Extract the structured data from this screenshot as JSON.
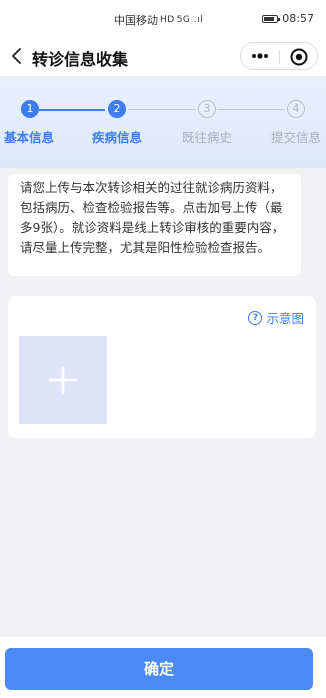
{
  "status_bar": {
    "carrier": "中国移动",
    "network": "HD",
    "signal": "5G .ıl",
    "time": "08:57",
    "battery_level": 0.8
  },
  "nav": {
    "title": "转诊信息收集",
    "back_icon": "chevron-left-icon",
    "more_icon": "more-dots-icon",
    "close_icon": "target-circle-icon"
  },
  "steps": [
    {
      "number": "1",
      "label": "基本信息",
      "state": "done"
    },
    {
      "number": "2",
      "label": "疾病信息",
      "state": "current"
    },
    {
      "number": "3",
      "label": "既往病史",
      "state": "pending"
    },
    {
      "number": "4",
      "label": "提交信息",
      "state": "pending"
    }
  ],
  "notice": {
    "text": "请您上传与本次转诊相关的过往就诊病历资料，包括病历、检查检验报告等。点击加号上传（最多9张）。就诊资料是线上转诊审核的重要内容，请尽量上传完整，尤其是阳性检验检查报告。"
  },
  "upload": {
    "example_label": "示意图",
    "example_icon": "question-circle-icon",
    "add_icon": "plus-icon"
  },
  "footer": {
    "confirm_label": "确定"
  },
  "colors": {
    "accent": "#3e7cf0",
    "button": "#4b8af3",
    "upload_box": "#dfe2f8",
    "background": "#f1f1f3"
  }
}
